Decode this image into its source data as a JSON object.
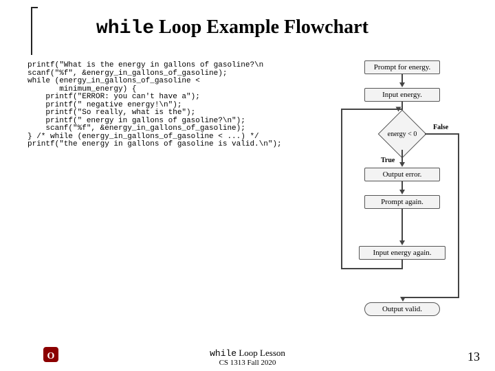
{
  "title_mono": "while",
  "title_rest": " Loop Example Flowchart",
  "code": "printf(\"What is the energy in gallons of gasoline?\\n\nscanf(\"%f\", &energy_in_gallons_of_gasoline);\nwhile (energy_in_gallons_of_gasoline <\n       minimum_energy) {\n    printf(\"ERROR: you can't have a\");\n    printf(\" negative energy!\\n\");\n    printf(\"So really, what is the\");\n    printf(\" energy in gallons of gasoline?\\n\");\n    scanf(\"%f\", &energy_in_gallons_of_gasoline);\n} /* while (energy_in_gallons_of_gasoline < ...) */\nprintf(\"the energy in gallons of gasoline is valid.\\n\");",
  "flow": {
    "b1": "Prompt for energy.",
    "b2": "Input energy.",
    "cond": "energy < 0",
    "true": "True",
    "false": "False",
    "b3": "Output error.",
    "b4": "Prompt again.",
    "b5": "Input energy again.",
    "b6": "Output valid."
  },
  "footer1_mono": "while",
  "footer1_rest": " Loop Lesson",
  "footer2": "CS 1313 Fall 2020",
  "page": "13"
}
